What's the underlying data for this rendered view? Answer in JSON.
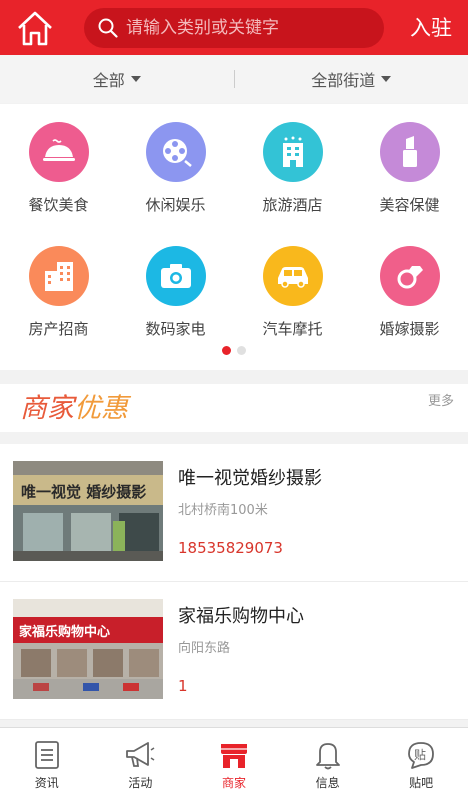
{
  "header": {
    "home_icon": "home-icon",
    "search_icon": "search-icon",
    "search_placeholder": "请输入类别或关键字",
    "join_label": "入驻"
  },
  "filter": {
    "all_label": "全部",
    "street_label": "全部街道"
  },
  "categories": [
    {
      "label": "餐饮美食",
      "icon": "food-icon",
      "color": "#ee5c8f"
    },
    {
      "label": "休闲娱乐",
      "icon": "film-reel-icon",
      "color": "#8c96f0"
    },
    {
      "label": "旅游酒店",
      "icon": "hotel-icon",
      "color": "#33c3d6"
    },
    {
      "label": "美容保健",
      "icon": "lipstick-icon",
      "color": "#c58ad8"
    },
    {
      "label": "房产招商",
      "icon": "building-icon",
      "color": "#fa8a5a"
    },
    {
      "label": "数码家电",
      "icon": "camera-icon",
      "color": "#1cb8e4"
    },
    {
      "label": "汽车摩托",
      "icon": "car-icon",
      "color": "#f9b81c"
    },
    {
      "label": "婚嫁摄影",
      "icon": "ring-icon",
      "color": "#f05f8a"
    }
  ],
  "pager": {
    "active_index": 0,
    "count": 2
  },
  "promo": {
    "title_part1": "商家",
    "title_part2": "优惠",
    "more_label": "更多"
  },
  "merchants": [
    {
      "name": "唯一视觉婚纱摄影",
      "address": "北村桥南100米",
      "phone": "18535829073",
      "sign_text": "唯一视觉 婚纱摄影"
    },
    {
      "name": "家福乐购物中心",
      "address": "向阳东路",
      "phone": "1",
      "sign_text": "家福乐购物中心"
    }
  ],
  "tabs": [
    {
      "label": "资讯",
      "icon": "news-icon",
      "active": false
    },
    {
      "label": "活动",
      "icon": "megaphone-icon",
      "active": false
    },
    {
      "label": "商家",
      "icon": "shop-icon",
      "active": true
    },
    {
      "label": "信息",
      "icon": "bell-icon",
      "active": false
    },
    {
      "label": "贴吧",
      "icon": "post-bubble-icon",
      "active": false,
      "icon_text": "贴"
    }
  ],
  "colors": {
    "brand": "#e8232a",
    "phone": "#d8352b"
  }
}
